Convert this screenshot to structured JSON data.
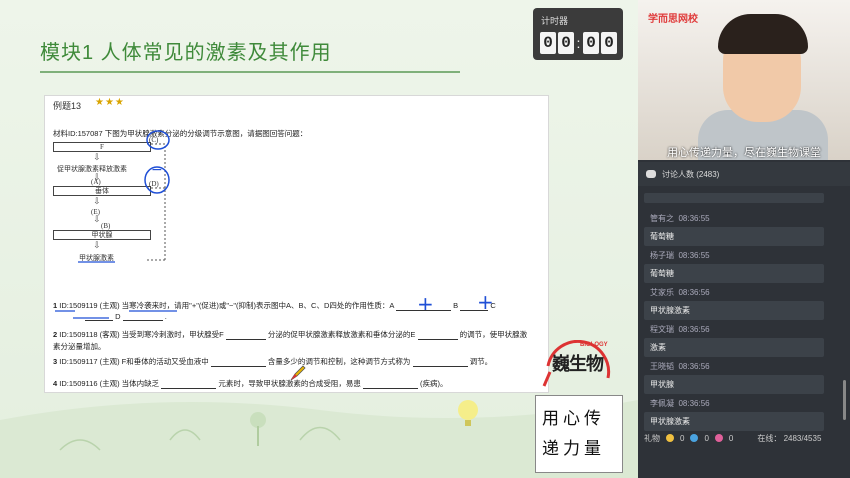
{
  "slide": {
    "title": "模块1   人体常见的激素及其作用",
    "timer": {
      "label": "计时器",
      "digits": [
        "0",
        "0",
        "0",
        "0"
      ]
    },
    "example": {
      "label": "例题13",
      "stars": "★★★"
    },
    "material": "材料ID:157087 下图为甲状腺激素分泌的分级调节示意图，请据图回答问题：",
    "diagram": {
      "box_f": "F",
      "label_trh": "促甲状腺激素释放激素",
      "label_a": "(A)",
      "box_chuiti": "垂体",
      "label_e": "(E)",
      "label_b": "(B)",
      "box_jiazhuangxian": "甲状腺",
      "label_th": "甲状腺激素",
      "label_c": "(C)",
      "label_d": "(D)"
    },
    "questions": [
      {
        "num": "1",
        "text_a": "ID:1509119 (主观)  当寒冷袭来时，请用\"+\"(促进)或\"−\"(抑制)表示图中A、B、C、D四处的作用性质：A",
        "text_b": "B",
        "text_c": "C",
        "text_d": "D",
        "end": "."
      },
      {
        "num": "2",
        "text_a": "ID:1509118 (客观)  当受到寒冷刺激时，甲状腺受F",
        "text_b": "分泌的促甲状腺激素释放激素和垂体分泌的E",
        "text_c": "的调节，使甲状腺激",
        "text_d": "素分泌量增加。"
      },
      {
        "num": "3",
        "text_a": "ID:1509117 (主观)  F和垂体的活动又受血液中",
        "text_b": "含量多少的调节和控制，这种调节方式称为",
        "text_c": "调节。"
      },
      {
        "num": "4",
        "text_a": "ID:1509116 (主观)  当体内缺乏",
        "text_b": "元素时，导致甲状腺激素的合成受阻，易患",
        "text_c": "(疾病)。"
      }
    ],
    "handwriting": {
      "plus_a": "+",
      "plus_b": "+",
      "minus": "−"
    },
    "logo": {
      "name": "巍生物",
      "tag": "BIOLOGY"
    },
    "slogan": [
      "用心传",
      "递力量"
    ]
  },
  "right": {
    "brand": "学而思网校",
    "caption": "用心传递力量，尽在巍生物课堂",
    "discussion": "讨论人数 (2483)",
    "messages": [
      {
        "user": "",
        "time": "",
        "text": ""
      },
      {
        "user": "管有之",
        "time": "08:36:55",
        "text": "葡萄糖"
      },
      {
        "user": "杨子瑞",
        "time": "08:36:55",
        "text": "葡萄糖"
      },
      {
        "user": "艾家乐",
        "time": "08:36:56",
        "text": "甲状腺激素"
      },
      {
        "user": "程文瑞",
        "time": "08:36:56",
        "text": "激素"
      },
      {
        "user": "王晓韬",
        "time": "08:36:56",
        "text": "甲状腺"
      },
      {
        "user": "李佩凝",
        "time": "08:36:56",
        "text": "甲状腺激素"
      }
    ],
    "footer": {
      "gifts_label": "礼物",
      "g1": "0",
      "g2": "0",
      "g3": "0",
      "online": "在线： 2483/4535"
    }
  }
}
